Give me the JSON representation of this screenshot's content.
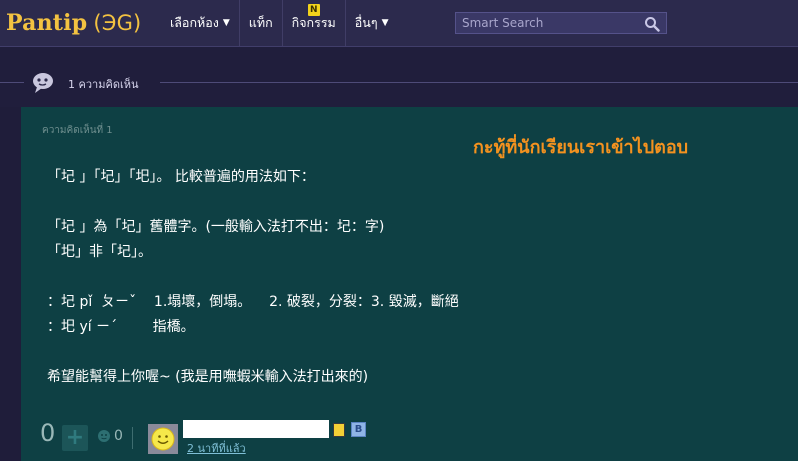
{
  "header": {
    "logo_text": "Pantip",
    "logo_mark": "(ЭG)",
    "nav": [
      {
        "label": "เลือกห้อง",
        "caret": "▼"
      },
      {
        "label": "แท็ก",
        "caret": ""
      },
      {
        "label": "กิจกรรม",
        "caret": "",
        "badge": "N"
      },
      {
        "label": "อื่นๆ",
        "caret": "▼"
      }
    ],
    "search_placeholder": "Smart Search",
    "accent": "#f3c241"
  },
  "separator": {
    "text": "1 ความคิดเห็น"
  },
  "comment": {
    "label": "ความคิดเห็นที่ 1",
    "overlay_title": "กะทู้ที่นักเรียนเราเข้าไปตอบ",
    "lines": [
      "「圮 」「圮」「圯」。 比較普遍的用法如下：",
      "",
      "「圮 」為「圮」舊體字。(一般輸入法打不出：圮：字)",
      "「圯」非「圮」。",
      "",
      "：圮 pǐ  ㄆㄧˇ    1.塌壞，倒塌。    2. 破裂，分裂：3. 毀滅，斷絕",
      "：圯 yí ㄧˊ        指橋。",
      "",
      "希望能幫得上你喔~ (我是用嘸蝦米輸入法打出來的)"
    ],
    "score": "0",
    "plus_label": "+",
    "emotion_count": "0",
    "time": "2 นาทีที่แล้ว"
  }
}
